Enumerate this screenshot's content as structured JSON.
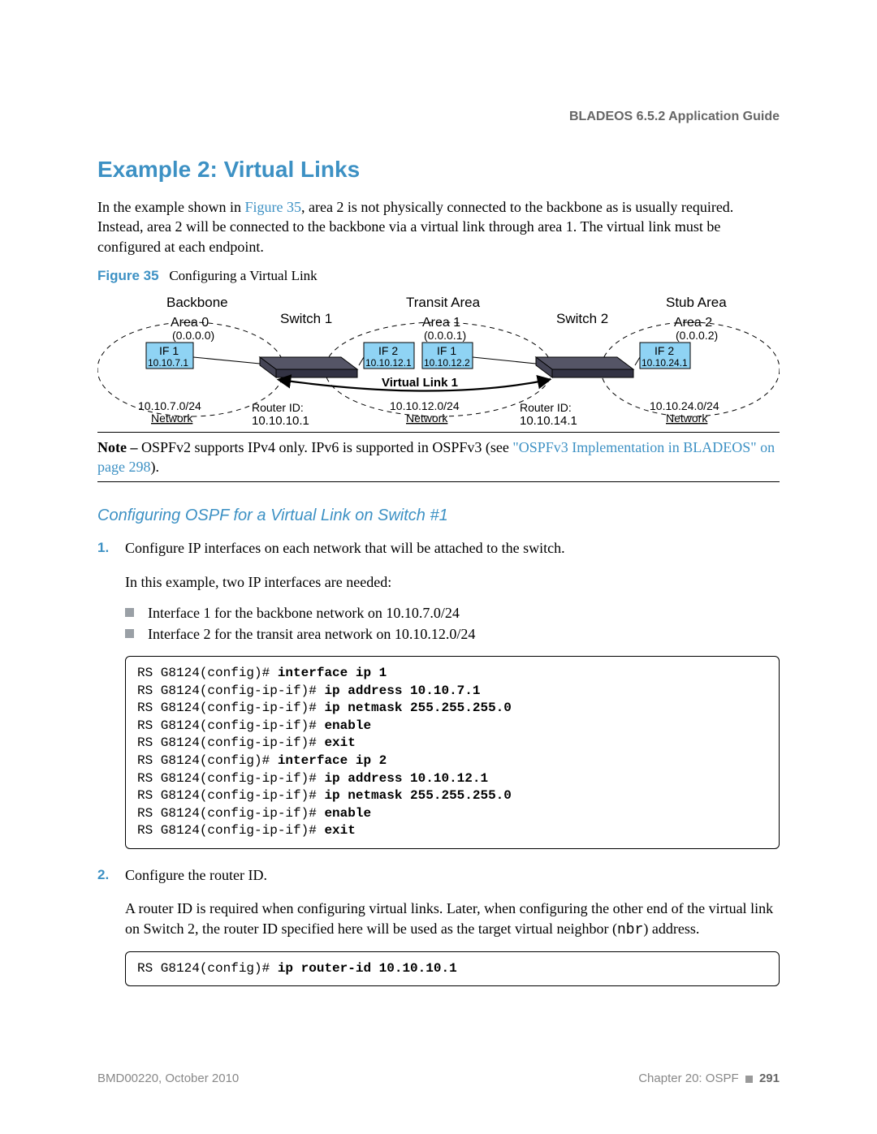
{
  "header": {
    "running_head": "BLADEOS 6.5.2 Application Guide"
  },
  "title": "Example 2: Virtual Links",
  "intro": {
    "pre": "In the example shown in ",
    "figref": "Figure 35",
    "post": ", area 2 is not physically connected to the backbone as is usually required. Instead, area 2 will be connected to the backbone via a virtual link through area 1. The virtual link must be configured at each endpoint."
  },
  "figure": {
    "label": "Figure 35",
    "desc": "Configuring a Virtual Link",
    "labels": {
      "backbone": "Backbone",
      "transit": "Transit Area",
      "stub": "Stub Area",
      "switch1": "Switch 1",
      "switch2": "Switch 2",
      "area0": "Area 0",
      "area0_id": "(0.0.0.0)",
      "area1": "Area 1",
      "area1_id": "(0.0.0.1)",
      "area2": "Area 2",
      "area2_id": "(0.0.0.2)",
      "if1": "IF 1",
      "if2": "IF 2",
      "s1_if1_ip": "10.10.7.1",
      "s1_if2_ip": "10.10.12.1",
      "s2_if1_ip": "10.10.12.2",
      "s2_if2_ip": "10.10.24.1",
      "vlink": "Virtual Link 1",
      "net1": "10.10.7.0/24",
      "net2": "10.10.12.0/24",
      "net3": "10.10.24.0/24",
      "netlabel": "Network",
      "rid": "Router ID:",
      "rid1": "10.10.10.1",
      "rid2": "10.10.14.1"
    }
  },
  "note": {
    "label": "Note –",
    "body_pre": " OSPFv2 supports IPv4 only. IPv6 is supported in OSPFv3 (see ",
    "link": "\"OSPFv3 Implementation in BLADEOS\" on page 298",
    "body_post": ")."
  },
  "subheading": "Configuring OSPF for a Virtual Link on Switch #1",
  "step1": {
    "text": "Configure IP interfaces on each network that will be attached to the switch.",
    "para": "In this example, two IP interfaces are needed:",
    "bul1": "Interface 1 for the backbone network on 10.10.7.0/24",
    "bul2": "Interface 2 for the transit area network on 10.10.12.0/24",
    "cli": {
      "l1p": "RS G8124(config)# ",
      "l1c": "interface ip 1",
      "l2p": "RS G8124(config-ip-if)# ",
      "l2c": "ip address 10.10.7.1",
      "l3p": "RS G8124(config-ip-if)# ",
      "l3c": "ip netmask 255.255.255.0",
      "l4p": "RS G8124(config-ip-if)# ",
      "l4c": "enable",
      "l5p": "RS G8124(config-ip-if)# ",
      "l5c": "exit",
      "l6p": "RS G8124(config)# ",
      "l6c": "interface ip 2",
      "l7p": "RS G8124(config-ip-if)# ",
      "l7c": "ip address 10.10.12.1",
      "l8p": "RS G8124(config-ip-if)# ",
      "l8c": "ip netmask 255.255.255.0",
      "l9p": "RS G8124(config-ip-if)# ",
      "l9c": "enable",
      "l10p": "RS G8124(config-ip-if)# ",
      "l10c": "exit"
    }
  },
  "step2": {
    "text": "Configure the router ID.",
    "para_a": "A router ID is required when configuring virtual links. Later, when configuring the other end of the virtual link on Switch 2, the router ID specified here will be used as the target virtual neighbor (",
    "nbr": "nbr",
    "para_b": ") address.",
    "cli": {
      "l1p": "RS G8124(config)# ",
      "l1c": "ip router-id 10.10.10.1"
    }
  },
  "footer": {
    "left": "BMD00220, October 2010",
    "chapter": "Chapter 20: OSPF",
    "page": "291"
  }
}
